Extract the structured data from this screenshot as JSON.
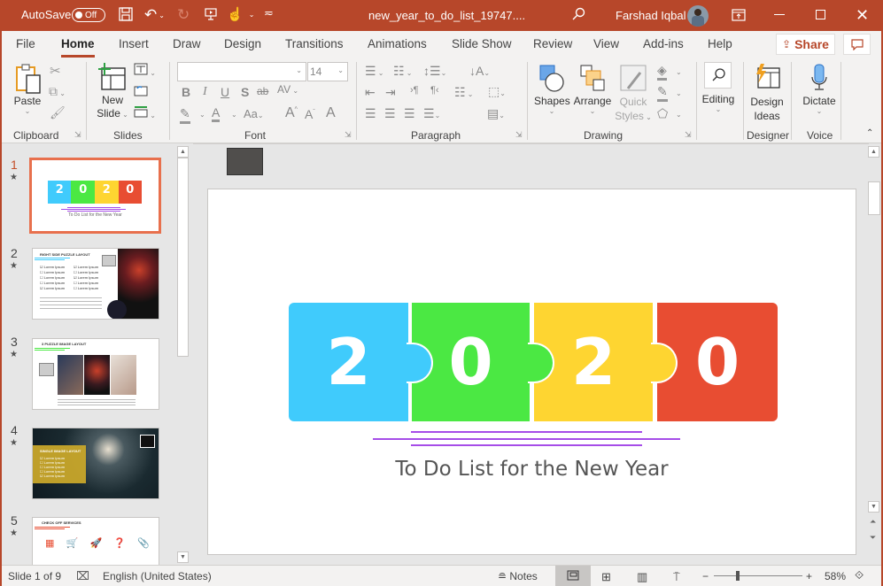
{
  "titlebar": {
    "autosave_label": "AutoSave",
    "autosave_state": "Off",
    "doc_title": "new_year_to_do_list_19747....",
    "user_name": "Farshad Iqbal",
    "icons": [
      "save-icon",
      "undo-icon",
      "redo-icon",
      "present-icon",
      "touch-mode-icon",
      "customize-qat-icon",
      "search-icon",
      "ribbon-display-icon",
      "minimize-icon",
      "maximize-icon",
      "close-icon"
    ]
  },
  "tabs": [
    {
      "label": "File"
    },
    {
      "label": "Home",
      "active": true
    },
    {
      "label": "Insert"
    },
    {
      "label": "Draw"
    },
    {
      "label": "Design"
    },
    {
      "label": "Transitions"
    },
    {
      "label": "Animations"
    },
    {
      "label": "Slide Show"
    },
    {
      "label": "Review"
    },
    {
      "label": "View"
    },
    {
      "label": "Add-ins"
    },
    {
      "label": "Help"
    }
  ],
  "share_label": "Share",
  "ribbon": {
    "clipboard": {
      "label": "Clipboard",
      "paste": "Paste"
    },
    "slides": {
      "label": "Slides",
      "new_slide_line1": "New",
      "new_slide_line2": "Slide"
    },
    "font": {
      "label": "Font",
      "font_name": "",
      "font_size": "14"
    },
    "paragraph": {
      "label": "Paragraph"
    },
    "drawing": {
      "label": "Drawing",
      "shapes": "Shapes",
      "arrange": "Arrange",
      "quick_styles_line1": "Quick",
      "quick_styles_line2": "Styles"
    },
    "editing": {
      "label": "Editing"
    },
    "designer": {
      "label": "Designer",
      "design_ideas_line1": "Design",
      "design_ideas_line2": "Ideas"
    },
    "voice": {
      "label": "Voice",
      "dictate": "Dictate"
    }
  },
  "thumbnails": [
    {
      "num": "1",
      "selected": true,
      "title": "2020",
      "caption": "To Do List for the New Year"
    },
    {
      "num": "2",
      "title": "RIGHT SIDE PUZZLE LAYOUT",
      "items": [
        "Lorem Ipsum",
        "Lorem Ipsum",
        "Lorem Ipsum",
        "Lorem Ipsum",
        "Lorem Ipsum"
      ]
    },
    {
      "num": "3",
      "title": "3 PUZZLE IMAGE LAYOUT"
    },
    {
      "num": "4",
      "title": "SINGLE IMAGE LAYOUT",
      "items": [
        "Lorem Ipsum",
        "Lorem Ipsum",
        "Lorem Ipsum",
        "Lorem Ipsum",
        "Lorem Ipsum"
      ]
    },
    {
      "num": "5",
      "title": "CHECK OFF SERVICES"
    }
  ],
  "slide": {
    "digits": [
      "2",
      "0",
      "2",
      "0"
    ],
    "colors": [
      "#40cbfc",
      "#4be843",
      "#fed531",
      "#e84d32"
    ],
    "line_color": "#a64de8",
    "subtitle": "To Do List for the New Year"
  },
  "status": {
    "slide_info": "Slide 1 of 9",
    "language": "English (United States)",
    "notes": "Notes",
    "zoom": "58%",
    "zoom_level_percent": 58
  }
}
